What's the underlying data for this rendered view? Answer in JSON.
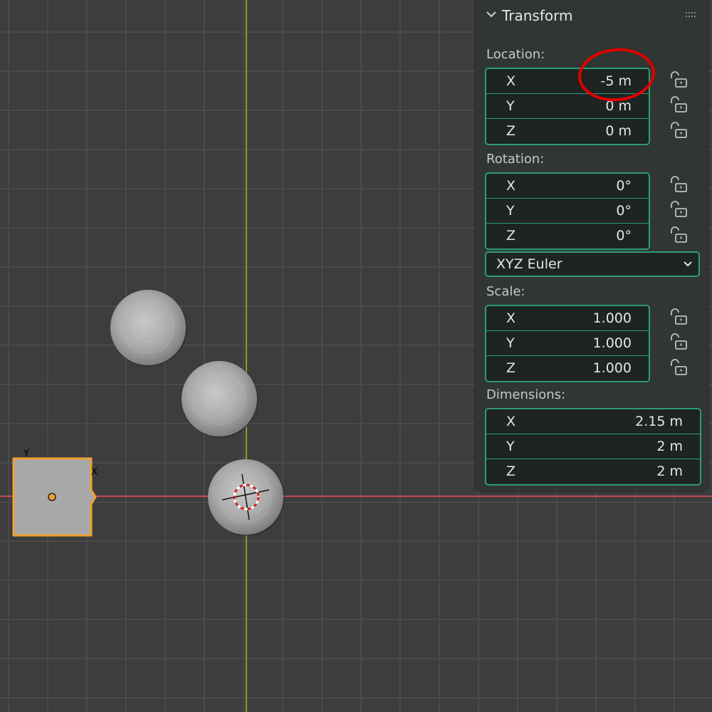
{
  "colors": {
    "grid_bg": "#3d3d3d",
    "grid_line": "#4a4a4a",
    "x_axis": "#c04a52",
    "y_axis": "#7aa82e",
    "panel_bg": "#303631",
    "field_border": "#2e9c76",
    "selection_outline": "#f0a030",
    "annotation_circle": "#e00000"
  },
  "viewport": {
    "selected_object": {
      "axis_x_label": "X",
      "axis_y_label": "Y"
    }
  },
  "panel": {
    "title": "Transform",
    "location": {
      "label": "Location:",
      "fields": [
        {
          "axis": "X",
          "value": "-5 m"
        },
        {
          "axis": "Y",
          "value": "0 m"
        },
        {
          "axis": "Z",
          "value": "0 m"
        }
      ]
    },
    "rotation": {
      "label": "Rotation:",
      "fields": [
        {
          "axis": "X",
          "value": "0°"
        },
        {
          "axis": "Y",
          "value": "0°"
        },
        {
          "axis": "Z",
          "value": "0°"
        }
      ],
      "mode": "XYZ Euler"
    },
    "scale": {
      "label": "Scale:",
      "fields": [
        {
          "axis": "X",
          "value": "1.000"
        },
        {
          "axis": "Y",
          "value": "1.000"
        },
        {
          "axis": "Z",
          "value": "1.000"
        }
      ]
    },
    "dimensions": {
      "label": "Dimensions:",
      "fields": [
        {
          "axis": "X",
          "value": "2.15 m"
        },
        {
          "axis": "Y",
          "value": "2 m"
        },
        {
          "axis": "Z",
          "value": "2 m"
        }
      ]
    }
  }
}
